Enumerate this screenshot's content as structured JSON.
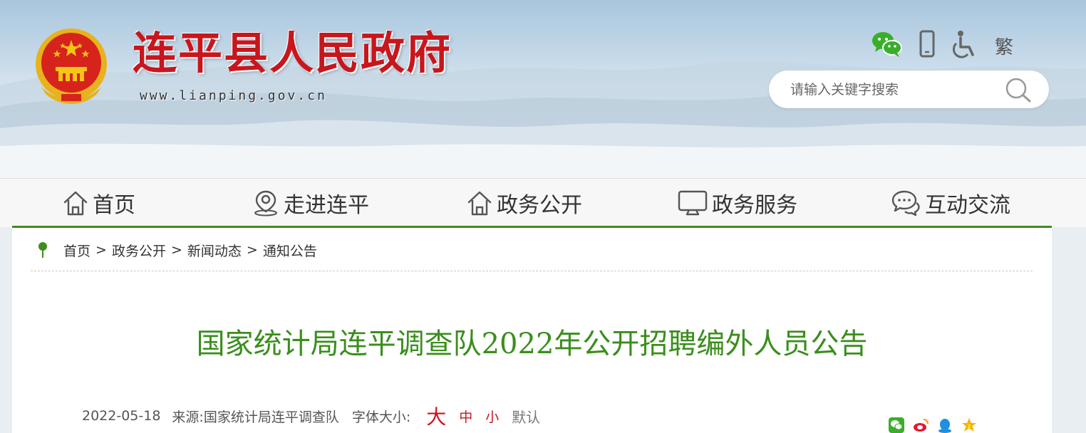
{
  "header": {
    "site_title": "连平县人民政府",
    "site_url": "www.lianping.gov.cn",
    "tools": {
      "wechat_icon": "wechat-icon",
      "mobile_icon": "mobile-phone-icon",
      "accessibility_icon": "accessibility-icon",
      "traditional_label": "繁"
    },
    "search": {
      "placeholder": "请输入关键字搜索",
      "value": ""
    }
  },
  "nav": {
    "items": [
      {
        "label": "首页",
        "icon": "home-icon"
      },
      {
        "label": "走进连平",
        "icon": "location-pin-icon"
      },
      {
        "label": "政务公开",
        "icon": "home-icon"
      },
      {
        "label": "政务服务",
        "icon": "monitor-icon"
      },
      {
        "label": "互动交流",
        "icon": "chat-bubbles-icon"
      }
    ]
  },
  "breadcrumb": {
    "icon": "location-pin-icon",
    "items": [
      "首页",
      "政务公开",
      "新闻动态",
      "通知公告"
    ],
    "separator": ">"
  },
  "article": {
    "title": "国家统计局连平调查队2022年公开招聘编外人员公告",
    "date": "2022-05-18",
    "source_label": "来源:",
    "source": "国家统计局连平调查队",
    "font_size_label": "字体大小:",
    "font_sizes": {
      "large": "大",
      "medium": "中",
      "small": "小",
      "default": "默认"
    },
    "share_icons": [
      "wechat-share-icon",
      "weibo-share-icon",
      "qq-share-icon",
      "qzone-share-icon"
    ]
  },
  "colors": {
    "title_red": "#c8161d",
    "accent_green": "#3f8d1f",
    "article_title_green": "#3a8e1c"
  }
}
